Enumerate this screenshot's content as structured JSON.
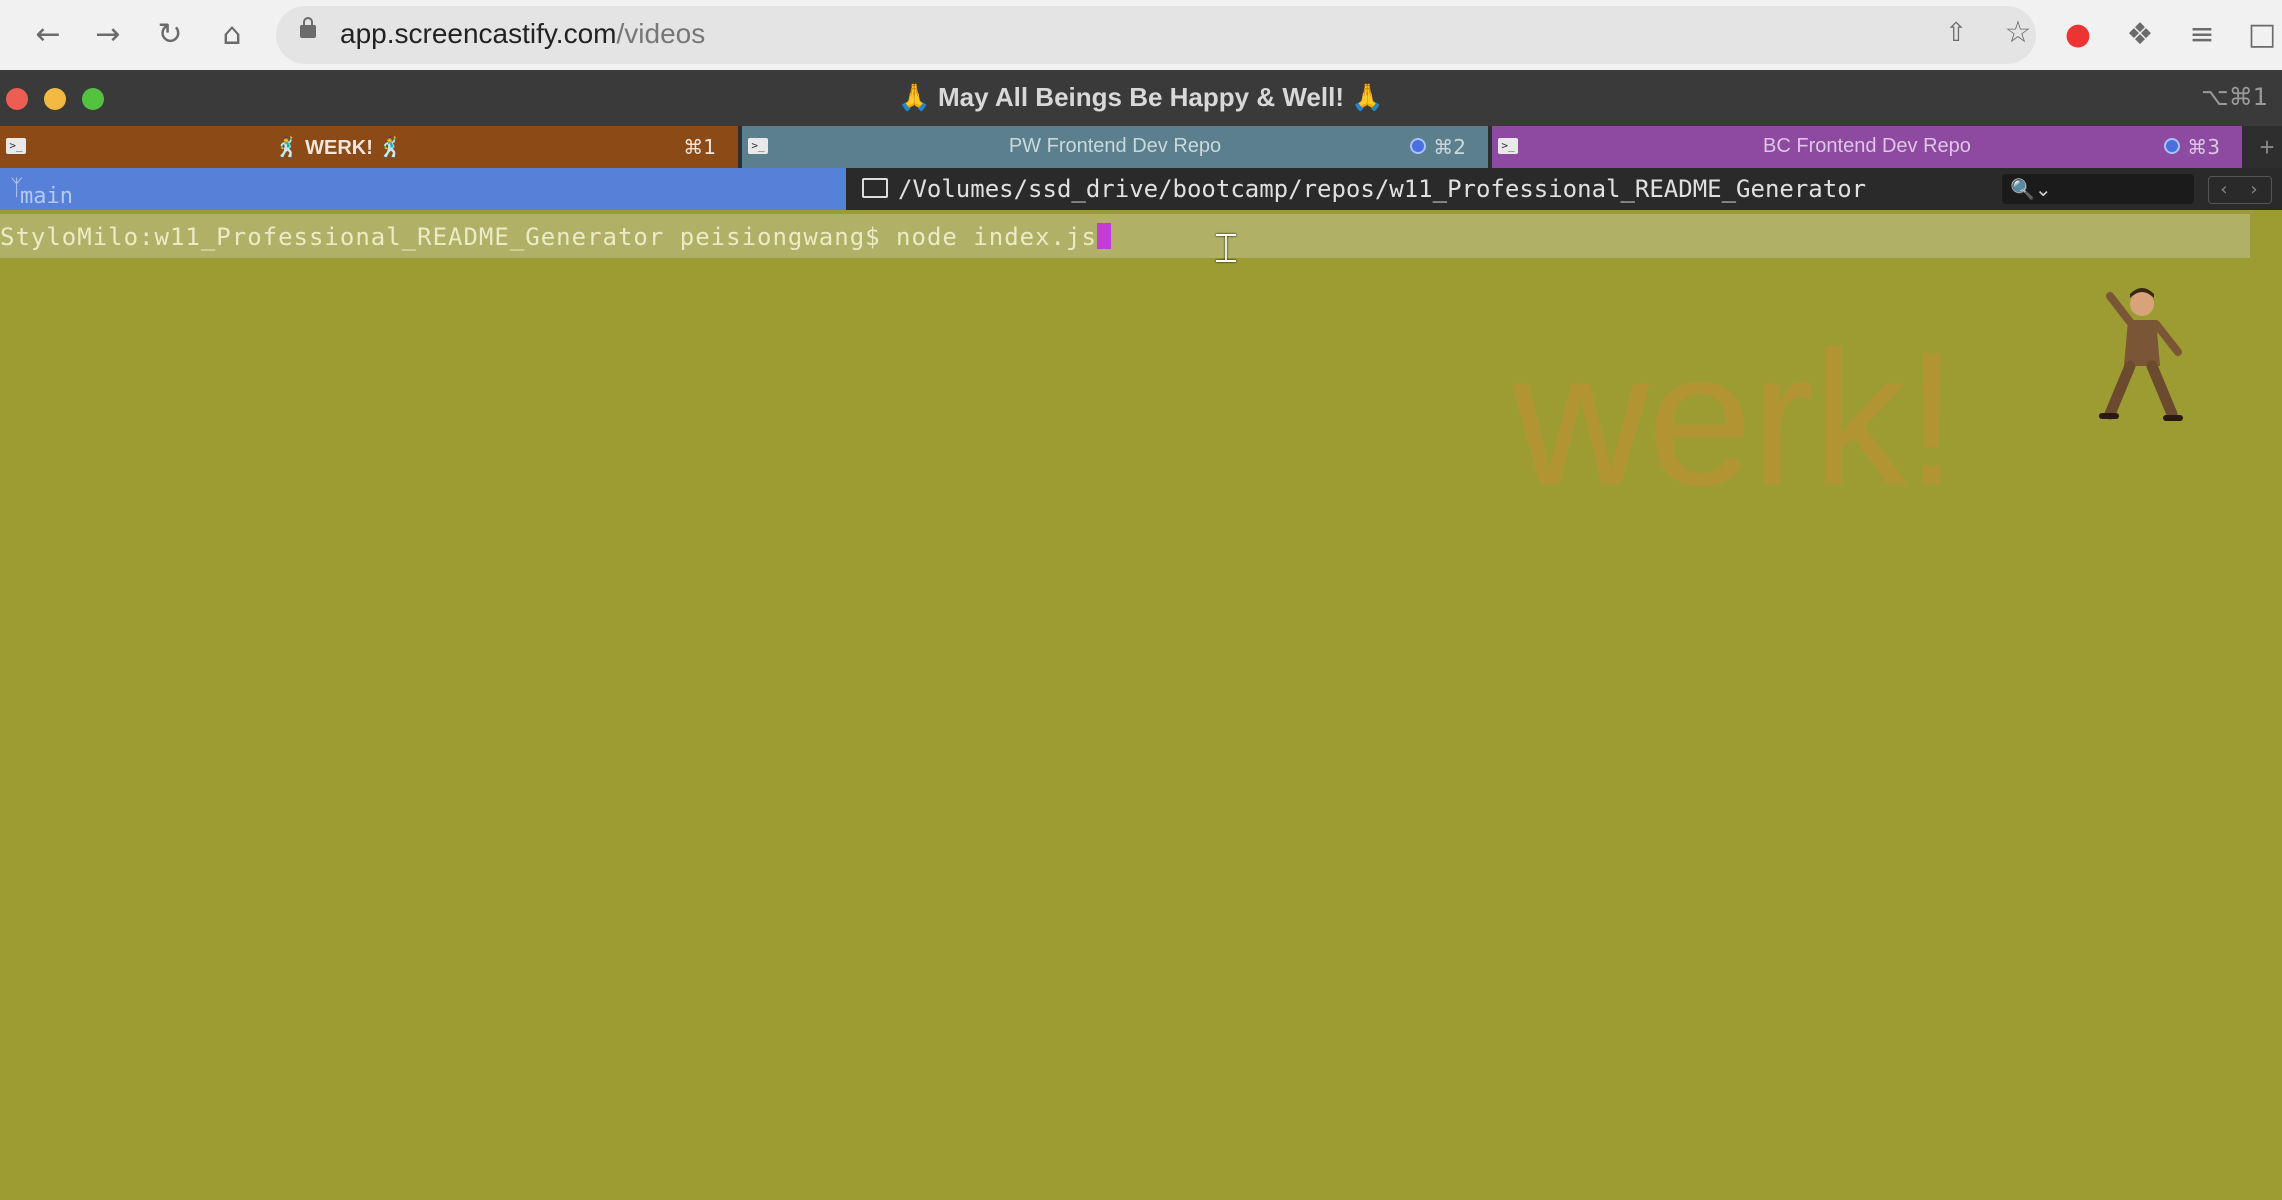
{
  "browser": {
    "url_host": "app.screencastify.com",
    "url_path": "/videos",
    "nav_icons": [
      "back-arrow-icon",
      "forward-arrow-icon",
      "reload-icon",
      "home-icon"
    ],
    "right_icons": [
      "share-icon",
      "bookmark-star-icon",
      "screencastify-icon",
      "extensions-icon",
      "reading-list-icon",
      "side-panel-icon"
    ]
  },
  "window": {
    "title": "🙏 May All Beings Be Happy & Well! 🙏",
    "shortcut": "⌥⌘1"
  },
  "tabs": [
    {
      "label": "🕺 WERK! 🕺",
      "shortcut": "⌘1",
      "color": "#8c4a16",
      "text_color": "#f1e6dc"
    },
    {
      "label": "PW Frontend Dev Repo",
      "shortcut": "⌘2",
      "color": "#5b7f8c",
      "text_color": "#c9d8dd"
    },
    {
      "label": "BC Frontend Dev Repo",
      "shortcut": "⌘3",
      "color": "#8e4aa0",
      "text_color": "#dcc6e4"
    }
  ],
  "status": {
    "branch": "main",
    "path": "/Volumes/ssd_drive/bootcamp/repos/w11_Professional_README_Generator",
    "branch_color": "#5780d8"
  },
  "terminal": {
    "prompt": "StyloMilo:w11_Professional_README_Generator peisiongwang$ node index.js",
    "watermark": "werk!",
    "background": "#9c9c32"
  }
}
